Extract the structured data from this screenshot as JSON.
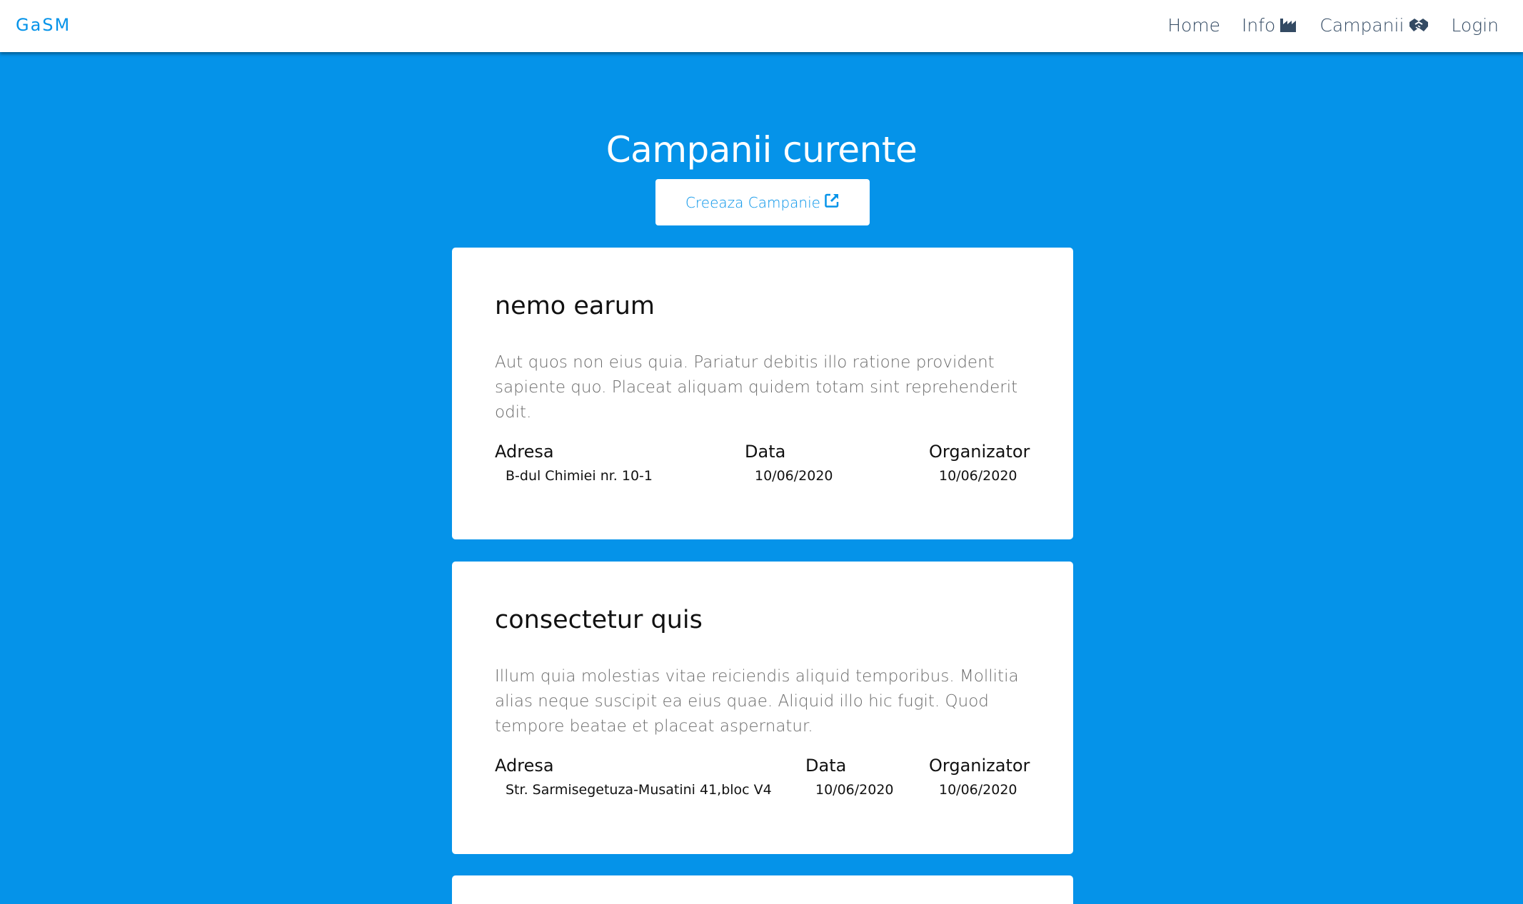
{
  "navbar": {
    "brand": "GaSM",
    "links": [
      {
        "label": "Home",
        "icon": ""
      },
      {
        "label": "Info",
        "icon": "industry-icon"
      },
      {
        "label": "Campanii",
        "icon": "handshake-icon"
      },
      {
        "label": "Login",
        "icon": ""
      }
    ]
  },
  "main": {
    "title": "Campanii curente",
    "create_button": {
      "label": "Creeaza Campanie",
      "icon": "external-link-icon"
    }
  },
  "campaigns": [
    {
      "title": "nemo earum",
      "description": "Aut quos non eius quia. Pariatur debitis illo ratione provident sapiente quo. Placeat aliquam quidem totam sint reprehenderit odit.",
      "labels": {
        "address": "Adresa",
        "date": "Data",
        "organizer": "Organizator"
      },
      "address": "B-dul Chimiei nr. 10-1",
      "date": "10/06/2020",
      "organizer": "10/06/2020"
    },
    {
      "title": "consectetur quis",
      "description": "Illum quia molestias vitae reiciendis aliquid temporibus. Mollitia alias neque suscipit ea eius quae. Aliquid illo hic fugit. Quod tempore beatae et placeat aspernatur.",
      "labels": {
        "address": "Adresa",
        "date": "Data",
        "organizer": "Organizator"
      },
      "address": "Str. Sarmisegetuza-Musatini 41,bloc V4",
      "date": "10/06/2020",
      "organizer": "10/06/2020"
    }
  ],
  "colors": {
    "background": "#0593e9",
    "brand": "#0593e9",
    "nav_text": "#334a63",
    "card": "#ffffff"
  }
}
